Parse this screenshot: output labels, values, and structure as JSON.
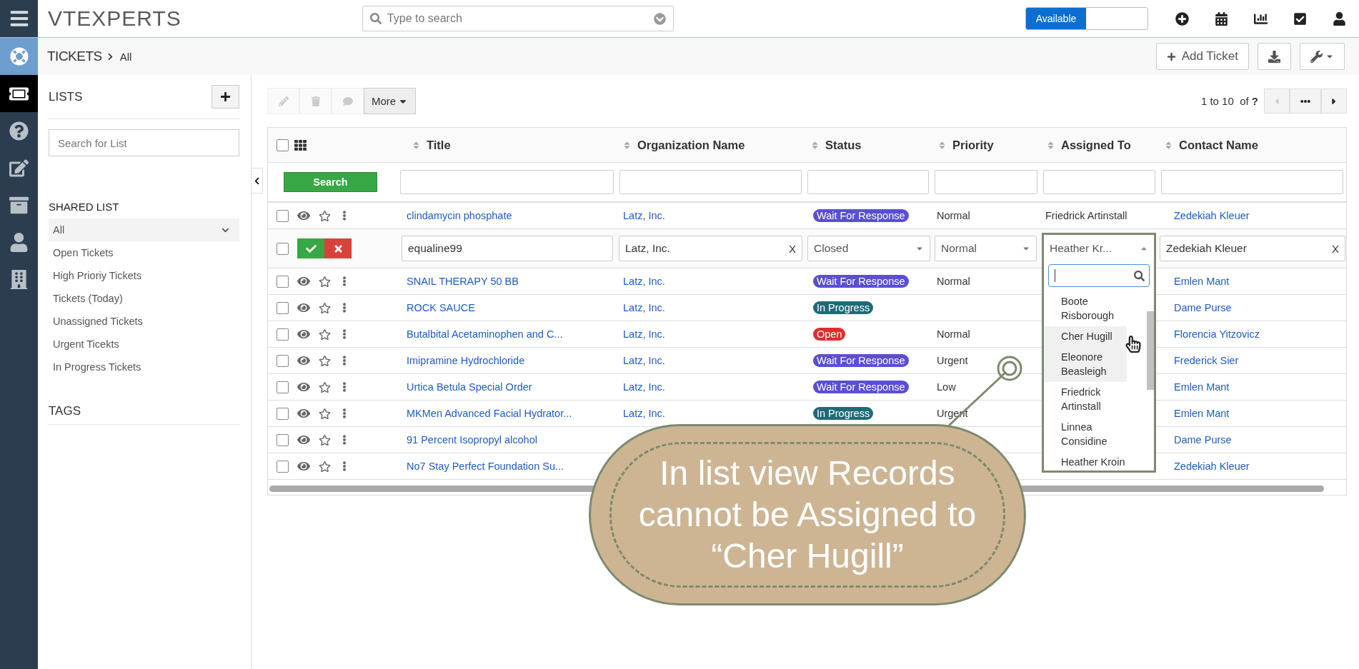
{
  "topbar": {
    "logo": "VTEXPERTS",
    "search_placeholder": "Type to search",
    "availability": {
      "label": "Available",
      "on": true
    }
  },
  "breadcrumb": {
    "module": "TICKETS",
    "current": "All",
    "add_button": "Add Ticket"
  },
  "rail": [
    {
      "selected": true
    },
    {
      "selected": false
    },
    {
      "selected": false
    },
    {
      "selected": false
    },
    {
      "selected": false
    },
    {
      "selected": false
    }
  ],
  "lists": {
    "title": "LISTS",
    "search_placeholder": "Search for List",
    "section": "SHARED LIST",
    "tags_title": "TAGS",
    "items": [
      {
        "label": "All",
        "selected": true
      },
      {
        "label": "Open Tickets",
        "selected": false
      },
      {
        "label": "High Prioriy Tickets",
        "selected": false
      },
      {
        "label": "Tickets (Today)",
        "selected": false
      },
      {
        "label": "Unassigned Tickets",
        "selected": false
      },
      {
        "label": "Urgent Ticekts",
        "selected": false
      },
      {
        "label": "In Progress Tickets",
        "selected": false
      }
    ]
  },
  "toolbar": {
    "actions": [
      {
        "disabled": true
      },
      {
        "disabled": true
      },
      {
        "disabled": true
      }
    ],
    "more": "More"
  },
  "pagination": {
    "range": "1 to 10",
    "of": "of",
    "total": "?",
    "prev_disabled": true
  },
  "table": {
    "select_all_checked": false,
    "search_button": "Search",
    "columns": [
      "Title",
      "Organization Name",
      "Status",
      "Priority",
      "Assigned To",
      "Contact Name"
    ],
    "rows": [
      {
        "kind": "record",
        "checked": false,
        "title": "clindamycin phosphate",
        "organization": "Latz, Inc.",
        "status": {
          "label": "Wait For Response",
          "color": "#5a4fd4"
        },
        "priority": "Normal",
        "assigned": "Friedrick Artinstall",
        "contact": "Zedekiah Kleuer"
      },
      {
        "kind": "edit",
        "checked": false,
        "title": "equaline99",
        "organization": "Latz, Inc.",
        "clear": "X",
        "status": "Closed",
        "priority": "Normal",
        "assigned": "Heather Kr...",
        "contact": "Zedekiah Kleuer",
        "contact_clear": "X"
      },
      {
        "kind": "record",
        "checked": false,
        "title": "SNAIL THERAPY 50 BB",
        "organization": "Latz, Inc.",
        "status": {
          "label": "Wait For Response",
          "color": "#5a4fd4"
        },
        "priority": "Normal",
        "contact": "Emlen Mant"
      },
      {
        "kind": "record",
        "checked": false,
        "title": "ROCK SAUCE",
        "organization": "Latz, Inc.",
        "status": {
          "label": "In Progress",
          "color": "#1f6b78"
        },
        "contact": "Dame Purse"
      },
      {
        "kind": "record",
        "checked": false,
        "title": "Butalbital Acetaminophen and C...",
        "organization": "Latz, Inc.",
        "status": {
          "label": "Open",
          "color": "#e42a2a"
        },
        "priority": "Normal",
        "contact": "Florencia Yitzovicz"
      },
      {
        "kind": "record",
        "checked": false,
        "title": "Imipramine Hydrochloride",
        "organization": "Latz, Inc.",
        "status": {
          "label": "Wait For Response",
          "color": "#5a4fd4"
        },
        "priority": "Urgent",
        "contact": "Frederick Sier"
      },
      {
        "kind": "record",
        "checked": false,
        "title": "Urtica Betula Special Order",
        "organization": "Latz, Inc.",
        "status": {
          "label": "Wait For Response",
          "color": "#5a4fd4"
        },
        "priority": "Low",
        "contact": "Emlen Mant"
      },
      {
        "kind": "record",
        "checked": false,
        "title": "MKMen Advanced Facial Hydrator...",
        "organization": "Latz, Inc.",
        "status": {
          "label": "In Progress",
          "color": "#1f6b78"
        },
        "priority": "Urgent",
        "contact": "Emlen Mant"
      },
      {
        "kind": "record",
        "checked": false,
        "title": "91 Percent Isopropyl alcohol",
        "contact": "Dame Purse"
      },
      {
        "kind": "record",
        "checked": false,
        "title": "No7 Stay Perfect Foundation Su...",
        "contact": "Zedekiah Kleuer"
      }
    ]
  },
  "dropdown": {
    "items": [
      {
        "label": "Boote Risborough",
        "highlighted": false
      },
      {
        "label": "Cher Hugill",
        "highlighted": true
      },
      {
        "label": "Eleonore Beasleigh",
        "highlighted": true
      },
      {
        "label": "Friedrick Artinstall",
        "highlighted": false
      },
      {
        "label": "Linnea Considine",
        "highlighted": false
      },
      {
        "label": "Heather Kroin",
        "highlighted": false
      }
    ]
  },
  "callout": {
    "text": "In list view Records cannot be Assigned to “Cher Hugill”"
  }
}
